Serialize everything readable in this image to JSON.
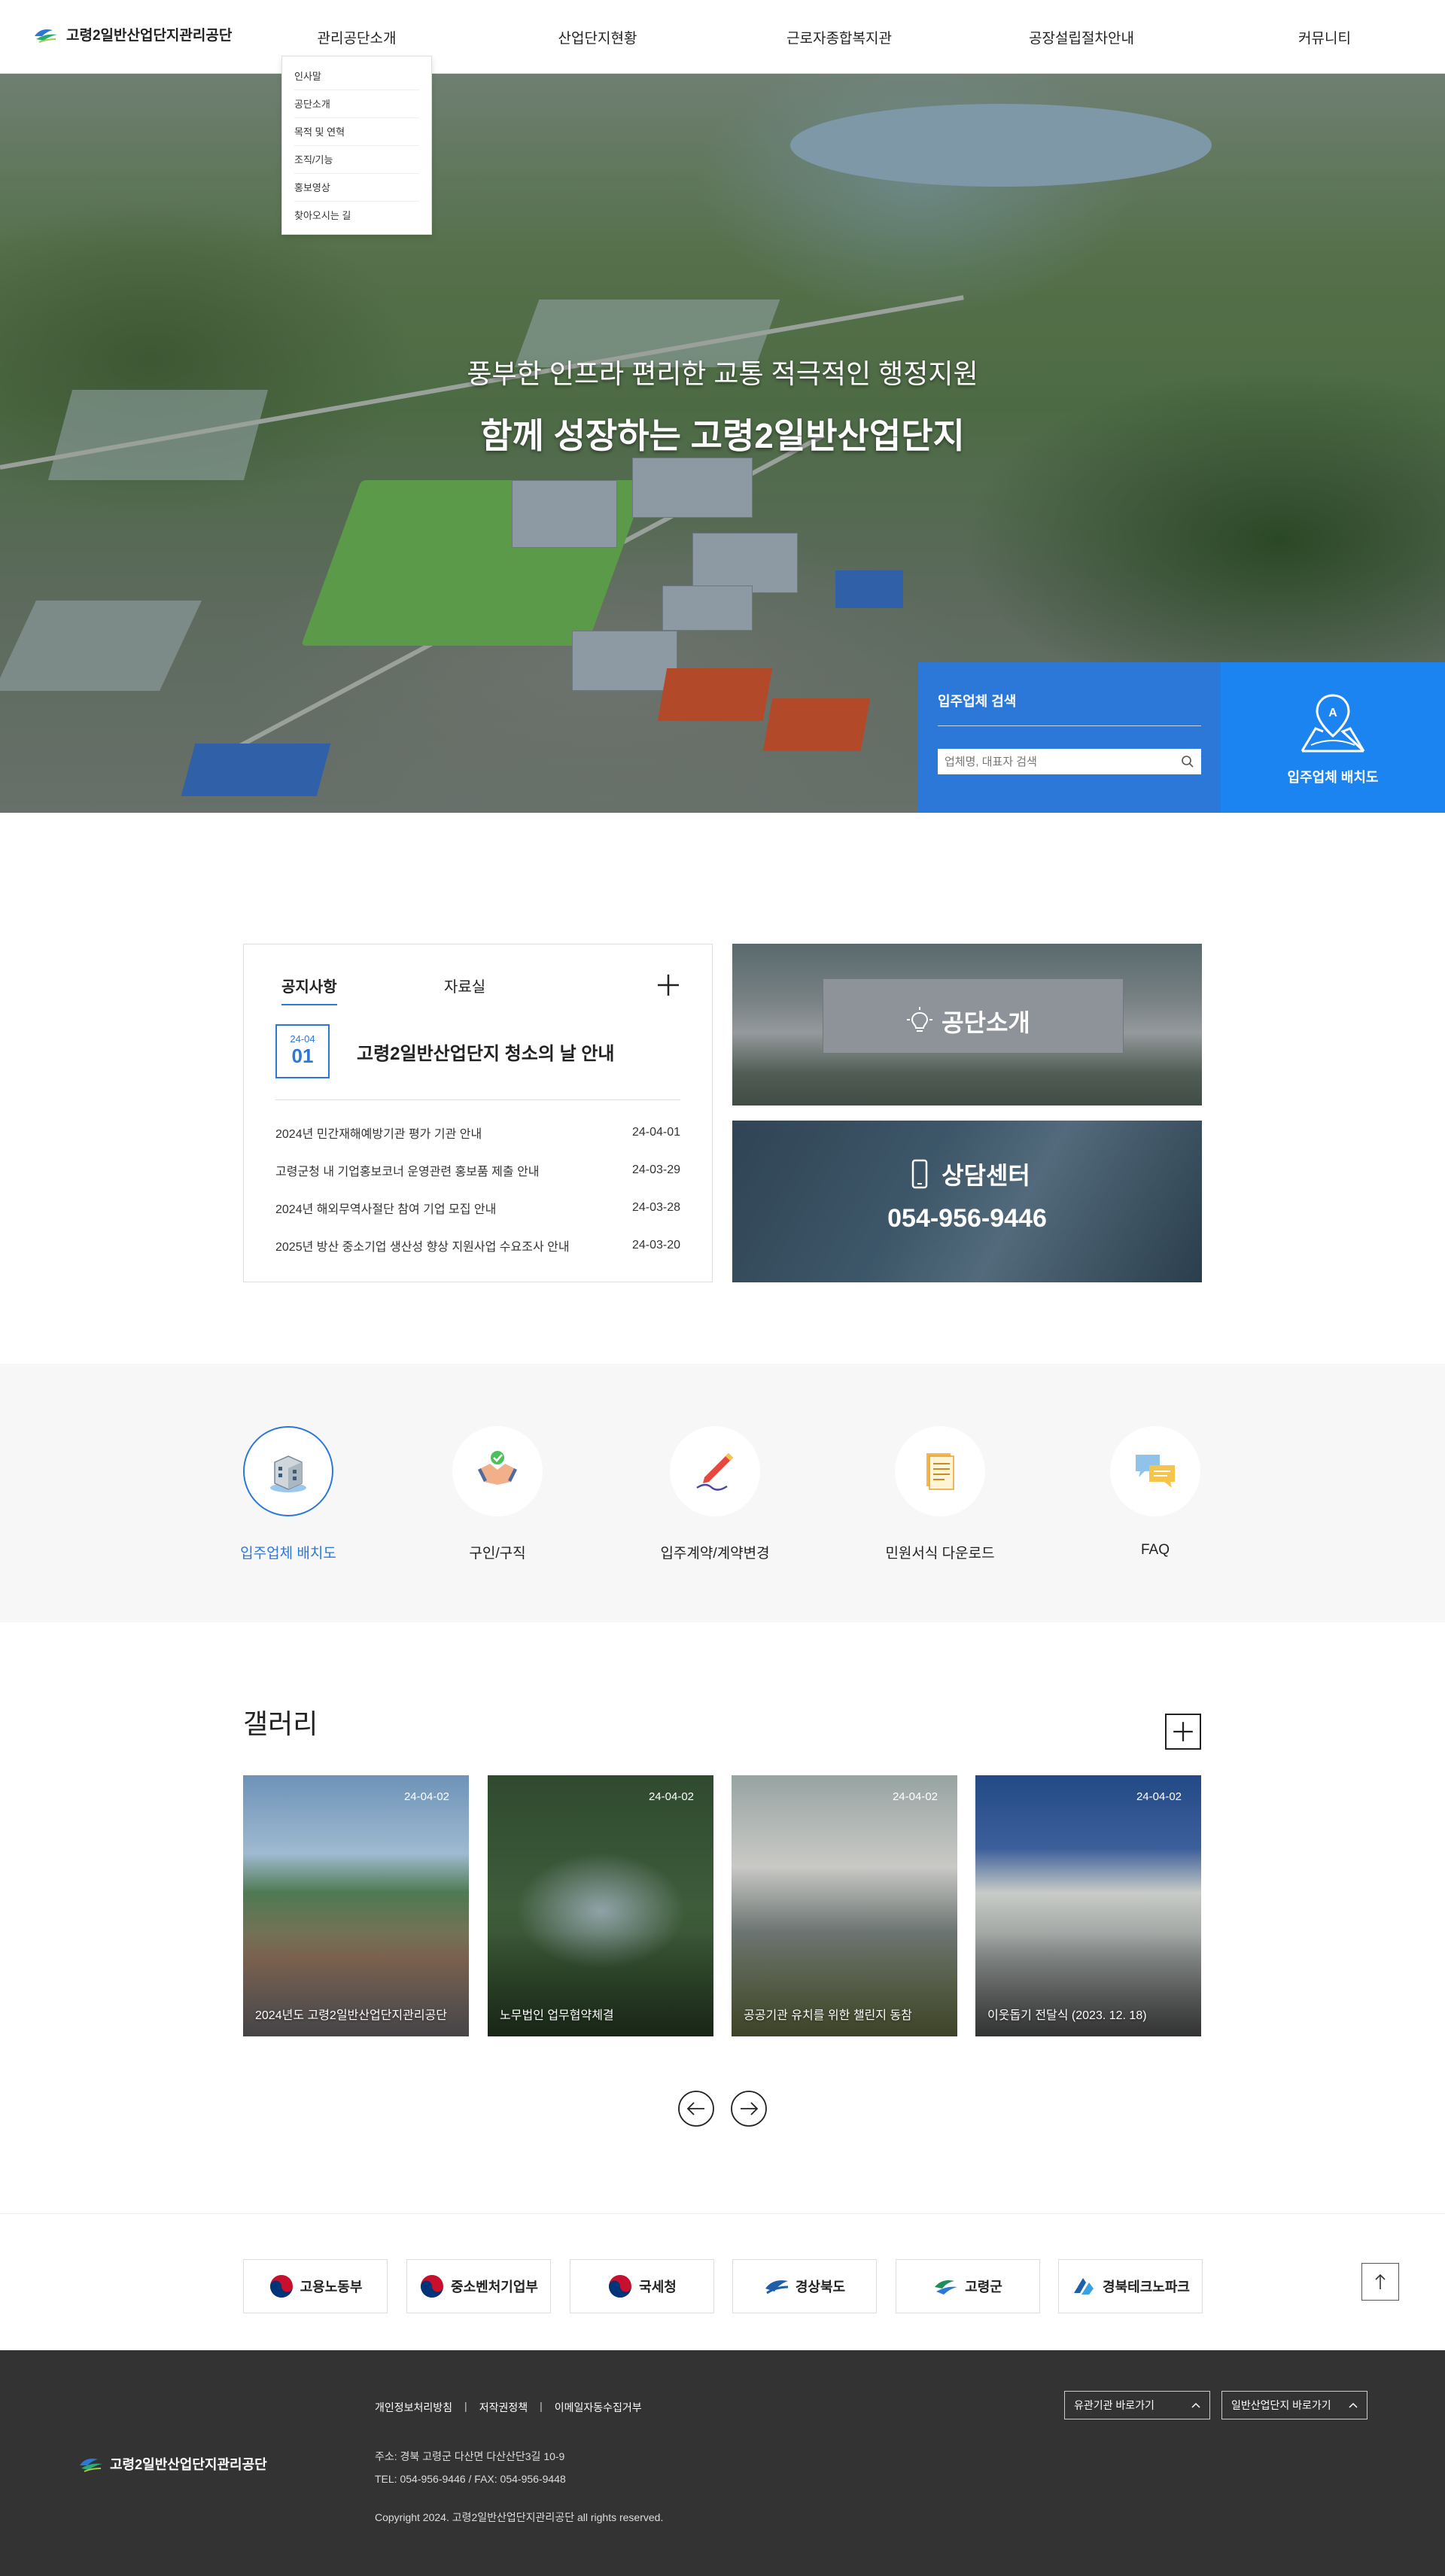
{
  "header": {
    "logo_text": "고령2일반산업단지관리공단",
    "nav": [
      "관리공단소개",
      "산업단지현황",
      "근로자종합복지관",
      "공장설립절차안내",
      "커뮤니티"
    ],
    "dropdown": [
      "인사말",
      "공단소개",
      "목적 및 연혁",
      "조직/기능",
      "홍보영상",
      "찾아오시는 길"
    ]
  },
  "hero": {
    "subtitle": "풍부한 인프라 편리한 교통 적극적인 행정지원",
    "title": "함께 성장하는 고령2일반산업단지",
    "search": {
      "title": "입주업체 검색",
      "placeholder": "업체명, 대표자 검색"
    },
    "map_label": "입주업체 배치도"
  },
  "notice": {
    "tabs": [
      "공지사항",
      "자료실"
    ],
    "featured": {
      "ym": "24-04",
      "day": "01",
      "title": "고령2일반산업단지 청소의 날 안내"
    },
    "items": [
      {
        "title": "2024년 민간재해예방기관 평가 기관 안내",
        "date": "24-04-01"
      },
      {
        "title": "고령군청 내 기업홍보코너 운영관련 홍보품 제출 안내",
        "date": "24-03-29"
      },
      {
        "title": "2024년 해외무역사절단 참여 기업 모집 안내",
        "date": "24-03-28"
      },
      {
        "title": "2025년 방산 중소기업 생산성 향상 지원사업 수요조사 안내",
        "date": "24-03-20"
      }
    ]
  },
  "promo": {
    "about_label": "공단소개",
    "center_label": "상담센터",
    "phone": "054-956-9446"
  },
  "quick_menu": [
    {
      "label": "입주업체 배치도",
      "icon": "building-icon",
      "active": true
    },
    {
      "label": "구인/구직",
      "icon": "handshake-icon",
      "active": false
    },
    {
      "label": "입주계약/계약변경",
      "icon": "pen-sign-icon",
      "active": false
    },
    {
      "label": "민원서식 다운로드",
      "icon": "document-icon",
      "active": false
    },
    {
      "label": "FAQ",
      "icon": "chat-bubbles-icon",
      "active": false
    }
  ],
  "gallery": {
    "title": "갤러리",
    "items": [
      {
        "date": "24-04-02",
        "caption": "2024년도 고령2일반산업단지관리공단"
      },
      {
        "date": "24-04-02",
        "caption": "노무법인 업무협약체결"
      },
      {
        "date": "24-04-02",
        "caption": "공공기관 유치를 위한 챌린지 동참"
      },
      {
        "date": "24-04-02",
        "caption": "이웃돕기 전달식 (2023. 12. 18)"
      }
    ]
  },
  "partners": [
    "고용노동부",
    "중소벤처기업부",
    "국세청",
    "경상북도",
    "고령군",
    "경북테크노파크"
  ],
  "footer": {
    "logo_text": "고령2일반산업단지관리공단",
    "links": [
      "개인정보처리방침",
      "저작권정책",
      "이메일자동수집거부"
    ],
    "address": "주소: 경북 고령군 다산면 다산산단3길 10-9",
    "contact": "TEL: 054-956-9446 / FAX: 054-956-9448",
    "copyright": "Copyright 2024. 고령2일반산업단지관리공단 all rights reserved.",
    "select1": "유관기관 바로가기",
    "select2": "일반산업단지 바로가기"
  },
  "colors": {
    "primary_blue": "#2c78d9",
    "map_blue": "#1c84f0",
    "footer_bg": "#333333",
    "quick_bg": "#f7f7f7"
  }
}
